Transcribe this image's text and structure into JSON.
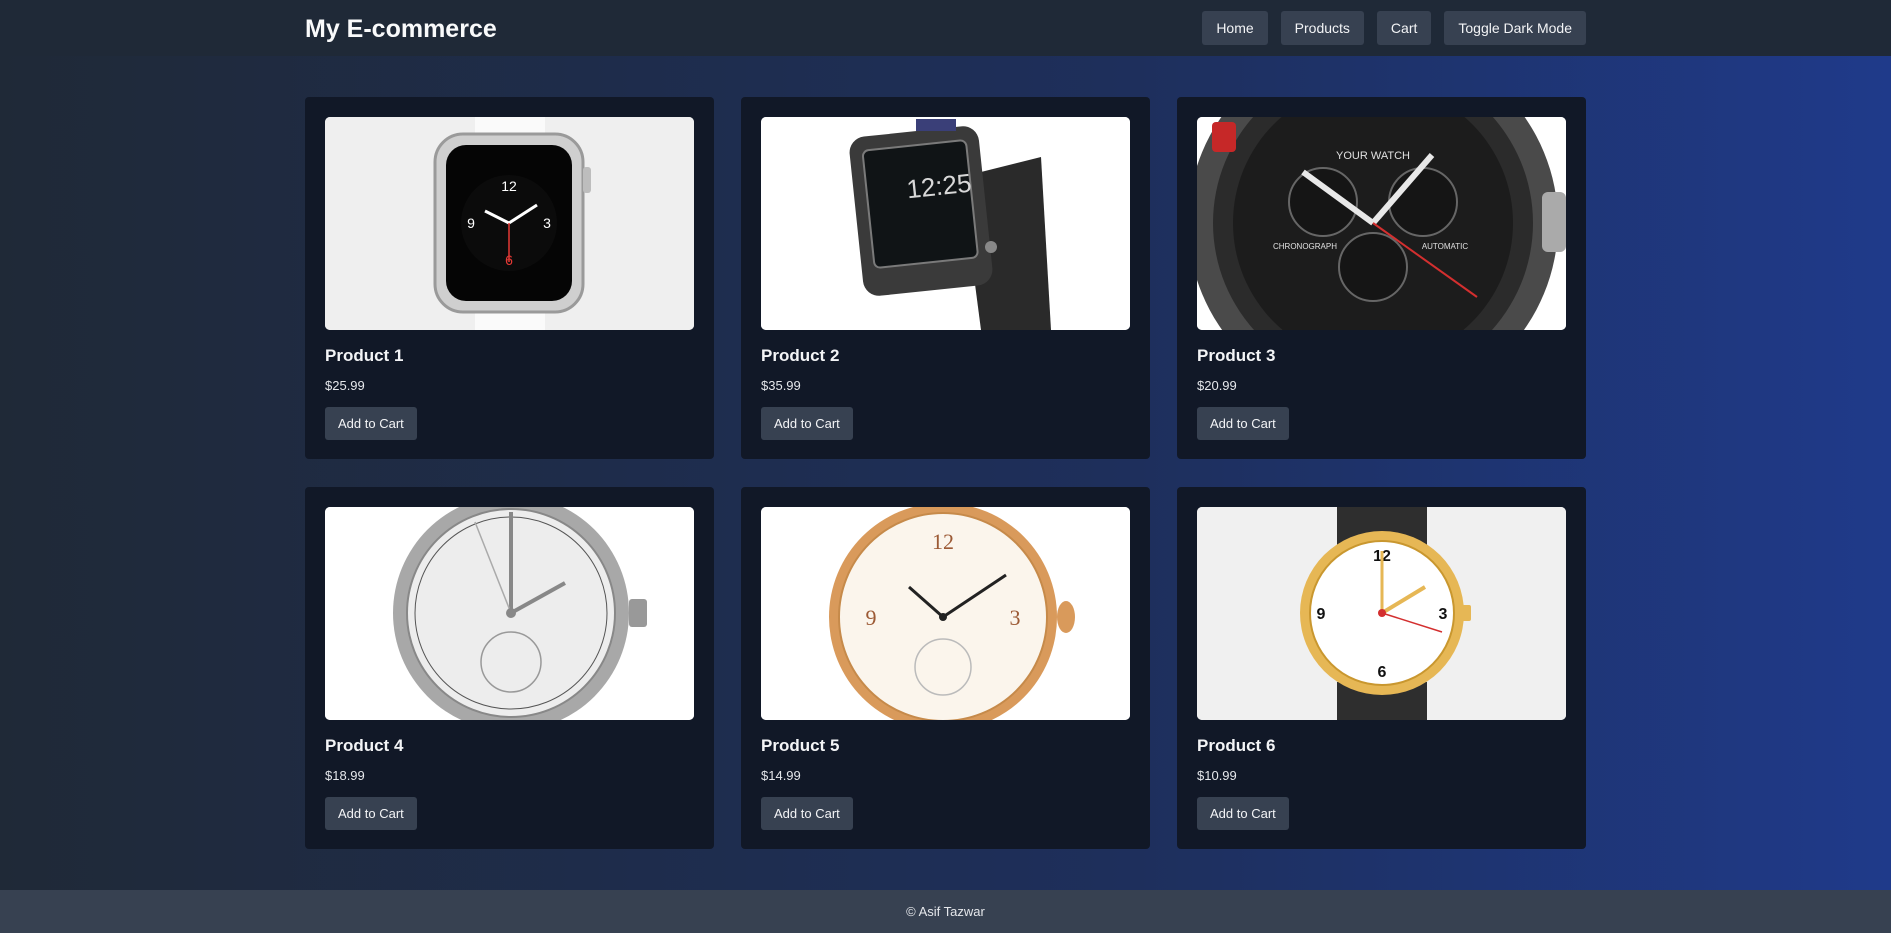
{
  "header": {
    "title": "My E-commerce",
    "nav": [
      {
        "label": "Home"
      },
      {
        "label": "Products"
      },
      {
        "label": "Cart"
      },
      {
        "label": "Toggle Dark Mode"
      }
    ]
  },
  "products": [
    {
      "name": "Product 1",
      "price": "$25.99",
      "button": "Add to Cart",
      "image": "smartwatch-white-icon"
    },
    {
      "name": "Product 2",
      "price": "$35.99",
      "button": "Add to Cart",
      "image": "smartwatch-black-icon"
    },
    {
      "name": "Product 3",
      "price": "$20.99",
      "button": "Add to Cart",
      "image": "chronograph-watch-icon"
    },
    {
      "name": "Product 4",
      "price": "$18.99",
      "button": "Add to Cart",
      "image": "silver-watch-icon"
    },
    {
      "name": "Product 5",
      "price": "$14.99",
      "button": "Add to Cart",
      "image": "gold-pocket-watch-icon"
    },
    {
      "name": "Product 6",
      "price": "$10.99",
      "button": "Add to Cart",
      "image": "gold-wristwatch-icon"
    }
  ],
  "footer": {
    "text": "© Asif Tazwar"
  },
  "colors": {
    "header_bg": "#1f2937",
    "card_bg": "#111827",
    "button_bg": "#374151",
    "footer_bg": "#374151"
  }
}
